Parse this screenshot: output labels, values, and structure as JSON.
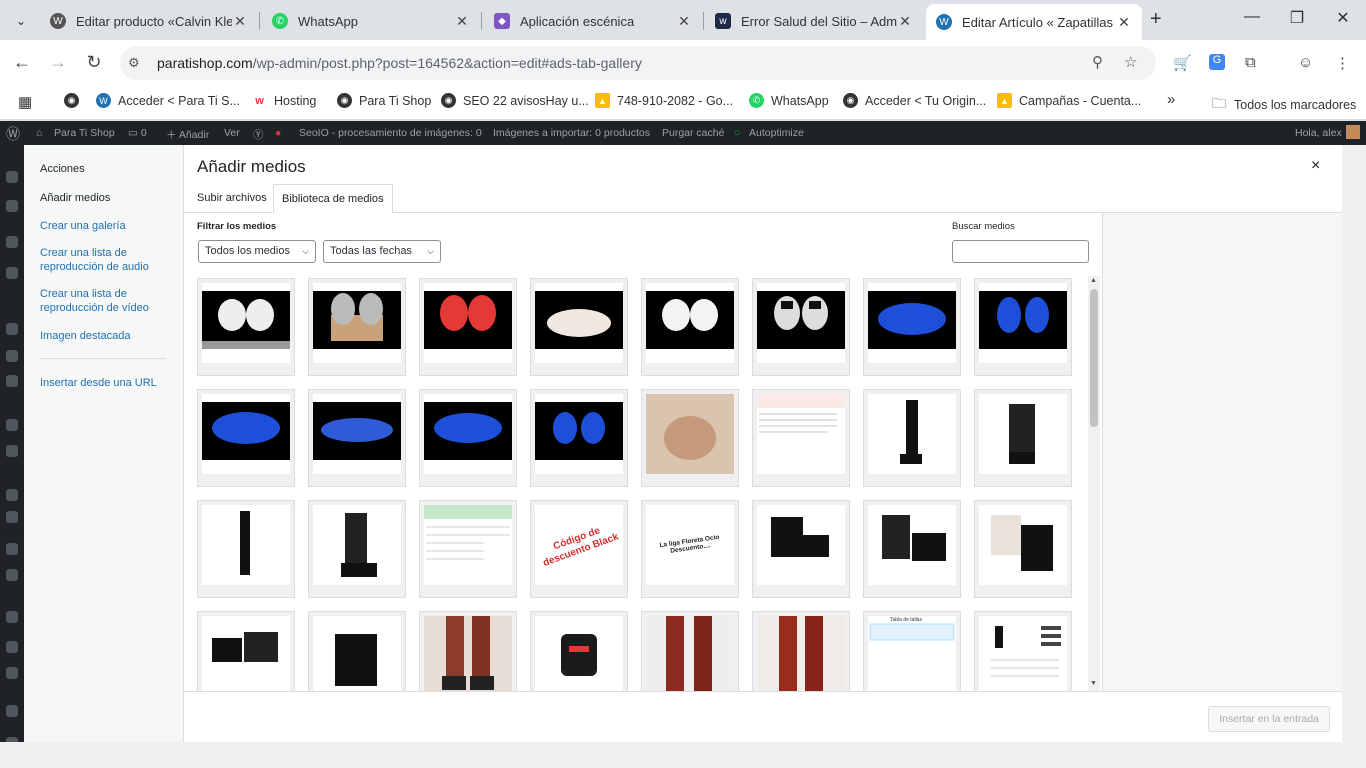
{
  "browser": {
    "tabs": [
      {
        "label": "Editar producto «Calvin Klein",
        "icon": "wordpress-icon",
        "close": "✕"
      },
      {
        "label": "WhatsApp",
        "icon": "whatsapp-icon",
        "close": "✕"
      },
      {
        "label": "Aplicación escénica",
        "icon": "app-icon",
        "close": "✕"
      },
      {
        "label": "Error Salud del Sitio – Admin",
        "icon": "w-icon",
        "close": "✕"
      },
      {
        "label": "Editar Artículo « Zapatillas Vo",
        "icon": "wordpress-icon",
        "close": "✕"
      }
    ],
    "url_host": "paratishop.com",
    "url_path": "/wp-admin/post.php?post=164562&action=edit#ads-tab-gallery",
    "bookmarks": [
      {
        "label": "Acceder < Para Ti S...",
        "icon": "wordpress-icon"
      },
      {
        "label": "Hosting",
        "icon": "hosting-icon"
      },
      {
        "label": "Para Ti Shop",
        "icon": "globe-icon"
      },
      {
        "label": "SEO 22 avisosHay u...",
        "icon": "globe-icon"
      },
      {
        "label": "748-910-2082 - Go...",
        "icon": "google-ads-icon"
      },
      {
        "label": "WhatsApp",
        "icon": "whatsapp-icon"
      },
      {
        "label": "Acceder < Tu Origin...",
        "icon": "globe-icon"
      },
      {
        "label": "Campañas - Cuenta...",
        "icon": "google-ads-icon"
      }
    ],
    "bookmarks_more": "»",
    "all_bookmarks": "Todos los marcadores"
  },
  "adminbar": {
    "site": "Para Ti Shop",
    "comments": "0",
    "add": "Añadir",
    "view": "Ver",
    "seoio": "SeoIO - procesamiento de imágenes: 0",
    "import": "Imágenes a importar: 0 productos",
    "purge": "Purgar caché",
    "autoptimize": "Autoptimize",
    "greeting": "Hola, alex"
  },
  "modal": {
    "title": "Añadir medios",
    "close": "×",
    "menu_heading": "Acciones",
    "menu": [
      "Añadir medios",
      "Crear una galería",
      "Crear una lista de reproducción de audio",
      "Crear una lista de reproducción de vídeo",
      "Imagen destacada",
      "Insertar desde una URL"
    ],
    "tabs": [
      "Subir archivos",
      "Biblioteca de medios"
    ],
    "filter_label": "Filtrar los medios",
    "filter_type": "Todos los medios",
    "filter_date": "Todas las fechas",
    "search_label": "Buscar medios",
    "search_value": "",
    "insert_button": "Insertar en la entrada",
    "thumb_texts": {
      "discount": "Código de descuento Black",
      "liga": "La liga Floreta Ocio Descuento....",
      "size": "Tabla de tallas"
    }
  },
  "colors": {
    "admin_bar": "#1d2327",
    "link": "#2271b1",
    "tab_bg": "#dee1e6"
  }
}
